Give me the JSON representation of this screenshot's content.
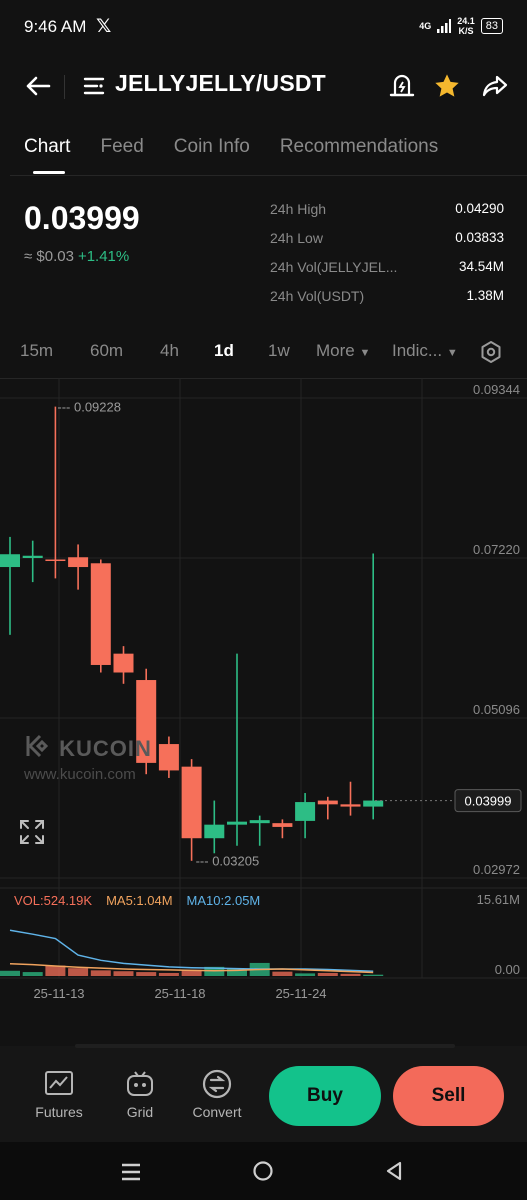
{
  "status_bar": {
    "time": "9:46 AM",
    "network": "4G",
    "speed_value": "24.1",
    "speed_unit": "K/S",
    "battery": "83"
  },
  "header": {
    "title": "JELLYJELLY/USDT"
  },
  "tabs": [
    {
      "label": "Chart",
      "active": true
    },
    {
      "label": "Feed",
      "active": false
    },
    {
      "label": "Coin Info",
      "active": false
    },
    {
      "label": "Recommendations",
      "active": false
    }
  ],
  "price": {
    "last": "0.03999",
    "approx": "≈ $0.03",
    "change": "+1.41%"
  },
  "stats": [
    {
      "label": "24h High",
      "value": "0.04290"
    },
    {
      "label": "24h Low",
      "value": "0.03833"
    },
    {
      "label": "24h Vol(JELLYJEL...",
      "value": "34.54M"
    },
    {
      "label": "24h Vol(USDT)",
      "value": "1.38M"
    }
  ],
  "timeframes": [
    {
      "label": "15m",
      "active": false
    },
    {
      "label": "60m",
      "active": false
    },
    {
      "label": "4h",
      "active": false
    },
    {
      "label": "1d",
      "active": true
    },
    {
      "label": "1w",
      "active": false
    },
    {
      "label": "More",
      "active": false
    },
    {
      "label": "Indic...",
      "active": false
    }
  ],
  "chart_data": {
    "type": "candlestick",
    "y_axis_ticks": [
      "0.09344",
      "0.07220",
      "0.05096",
      "0.02972"
    ],
    "current_price_tag": "0.03999",
    "high_annotation": "0.09228",
    "low_annotation": "0.03205",
    "x_ticks": [
      "25-11-13",
      "25-11-18",
      "25-11-24"
    ],
    "ylim": [
      0.02972,
      0.09344
    ],
    "candles": [
      {
        "o": 0.071,
        "h": 0.075,
        "l": 0.062,
        "c": 0.0727
      },
      {
        "o": 0.0722,
        "h": 0.0745,
        "l": 0.069,
        "c": 0.0725
      },
      {
        "o": 0.072,
        "h": 0.0923,
        "l": 0.0695,
        "c": 0.0718
      },
      {
        "o": 0.0723,
        "h": 0.074,
        "l": 0.068,
        "c": 0.071
      },
      {
        "o": 0.0715,
        "h": 0.072,
        "l": 0.057,
        "c": 0.058
      },
      {
        "o": 0.0595,
        "h": 0.0605,
        "l": 0.0555,
        "c": 0.057
      },
      {
        "o": 0.056,
        "h": 0.0575,
        "l": 0.0435,
        "c": 0.045
      },
      {
        "o": 0.0475,
        "h": 0.0485,
        "l": 0.043,
        "c": 0.044
      },
      {
        "o": 0.0445,
        "h": 0.0455,
        "l": 0.032,
        "c": 0.035
      },
      {
        "o": 0.035,
        "h": 0.04,
        "l": 0.033,
        "c": 0.0368
      },
      {
        "o": 0.0368,
        "h": 0.0595,
        "l": 0.034,
        "c": 0.0372
      },
      {
        "o": 0.037,
        "h": 0.038,
        "l": 0.034,
        "c": 0.0374
      },
      {
        "o": 0.037,
        "h": 0.0375,
        "l": 0.035,
        "c": 0.0365
      },
      {
        "o": 0.0373,
        "h": 0.041,
        "l": 0.035,
        "c": 0.0398
      },
      {
        "o": 0.04,
        "h": 0.0405,
        "l": 0.0375,
        "c": 0.0395
      },
      {
        "o": 0.0395,
        "h": 0.0425,
        "l": 0.038,
        "c": 0.0392
      },
      {
        "o": 0.0392,
        "h": 0.0728,
        "l": 0.0375,
        "c": 0.04
      }
    ],
    "volume": {
      "title": "VOL:524.19K",
      "ma5": "MA5:1.04M",
      "ma10": "MA10:2.05M",
      "max_label": "15.61M",
      "min_label": "0.00",
      "ylim": [
        0,
        15.61
      ],
      "values": [
        1.2,
        0.9,
        2.4,
        1.8,
        1.3,
        1.1,
        0.9,
        0.7,
        1.4,
        2.1,
        1.6,
        3.0,
        1.0,
        0.6,
        0.7,
        0.5,
        0.3
      ],
      "ma5_values": [
        2.8,
        2.6,
        2.3,
        2.0,
        1.8,
        1.6,
        1.5,
        1.4,
        1.3,
        1.2,
        1.3,
        1.5,
        1.6,
        1.4,
        1.2,
        1.0,
        0.8
      ],
      "ma10_values": [
        10.5,
        9.6,
        8.6,
        4.8,
        3.6,
        2.9,
        2.5,
        2.1,
        1.9,
        1.8,
        1.7,
        1.6,
        1.6,
        1.6,
        1.5,
        1.3,
        1.1
      ]
    },
    "colors": {
      "up": "#2dbd85",
      "down": "#f6705a",
      "ma5": "#f0a35e",
      "ma10": "#5fb3e8"
    }
  },
  "watermark": {
    "brand": "KUCOIN",
    "url": "www.kucoin.com"
  },
  "bottom_nav": [
    {
      "label": "Futures",
      "icon": "futures-chart-icon"
    },
    {
      "label": "Grid",
      "icon": "grid-bot-icon"
    },
    {
      "label": "Convert",
      "icon": "convert-icon"
    }
  ],
  "actions": {
    "buy": "Buy",
    "sell": "Sell"
  }
}
